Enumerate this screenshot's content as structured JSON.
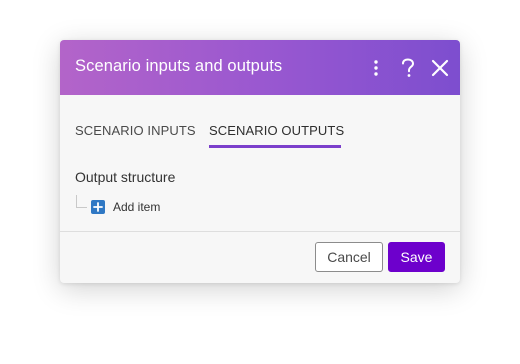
{
  "dialog": {
    "title": "Scenario inputs and outputs",
    "header_icons": [
      "more-vertical-icon",
      "help-icon",
      "close-icon"
    ],
    "colors": {
      "header_gradient_start": "#b364c9",
      "header_gradient_end": "#7d4ecf",
      "accent": "#7b3fcb",
      "save_button": "#6d00cc",
      "add_icon": "#2f78c4"
    }
  },
  "tabs": [
    {
      "label": "SCENARIO INPUTS",
      "active": false
    },
    {
      "label": "SCENARIO OUTPUTS",
      "active": true
    }
  ],
  "content": {
    "section_title": "Output structure",
    "add_item_label": "Add item"
  },
  "footer": {
    "cancel_label": "Cancel",
    "save_label": "Save"
  }
}
